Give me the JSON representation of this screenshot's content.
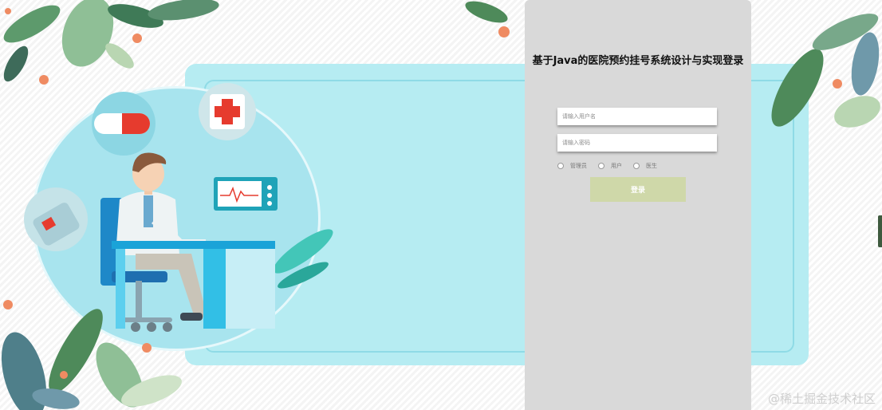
{
  "login": {
    "title": "基于Java的医院预约挂号系统设计与实现登录",
    "username_placeholder": "请输入用户名",
    "password_placeholder": "请输入密码",
    "roles": [
      {
        "label": "管理员"
      },
      {
        "label": "用户"
      },
      {
        "label": "医生"
      }
    ],
    "submit_label": "登录"
  },
  "watermark": "@稀土掘金技术社区",
  "colors": {
    "panel_bg": "#d9d9d9",
    "button_bg": "#cfd8a9",
    "card_bg": "#b6ecf2",
    "accent_red": "#e63b2e",
    "leaf_green": "#4e8a5a"
  },
  "icons": [
    "pill-icon",
    "medical-cross-icon",
    "heart-monitor-icon",
    "doctor-illustration"
  ]
}
